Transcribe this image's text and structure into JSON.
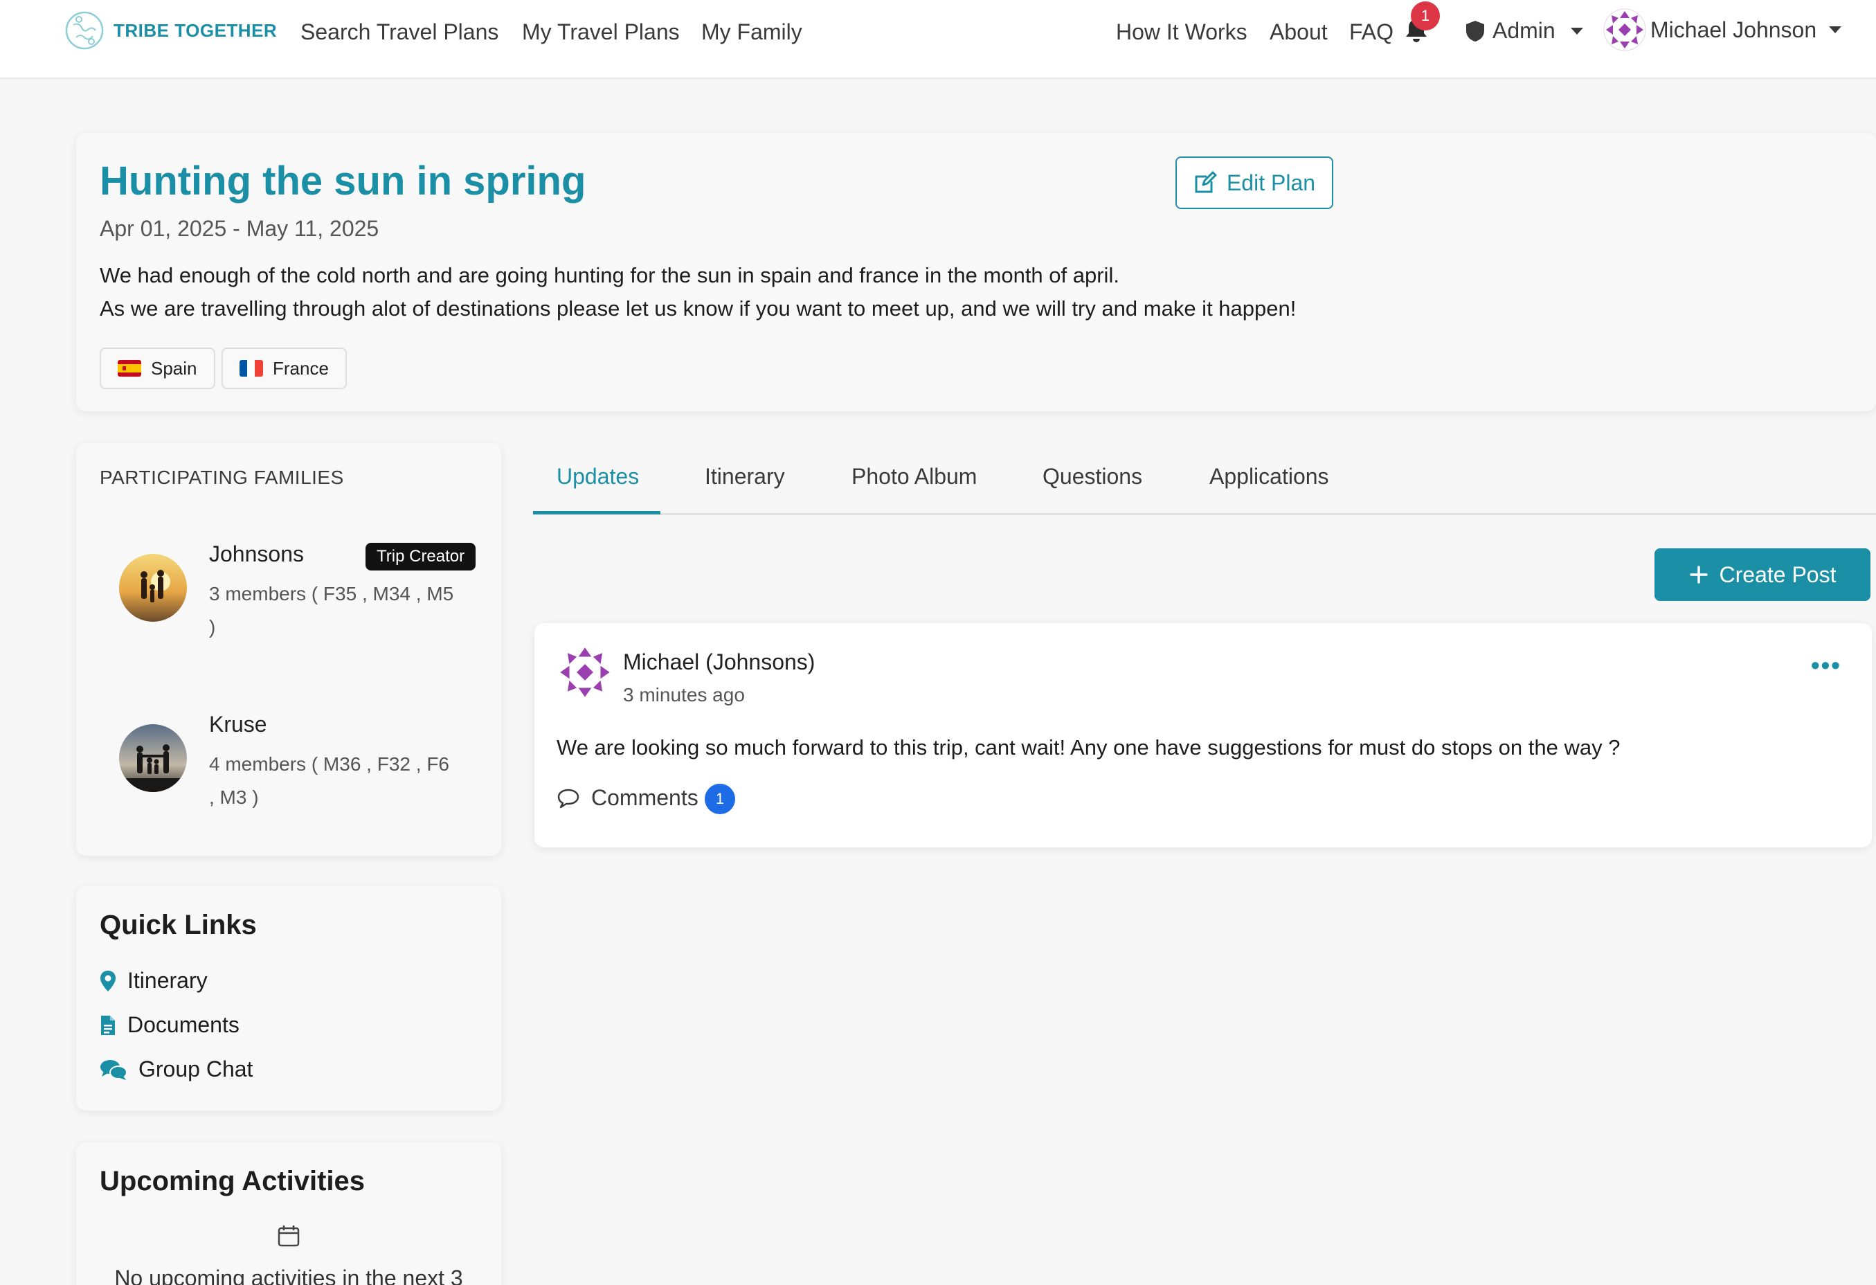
{
  "navbar": {
    "brand": "TRIBE TOGETHER",
    "links": [
      "Search Travel Plans",
      "My Travel Plans",
      "My Family"
    ],
    "right_links": [
      "How It Works",
      "About",
      "FAQ"
    ],
    "notification_count": "1",
    "admin_label": "Admin",
    "user_name": "Michael Johnson"
  },
  "plan": {
    "title": "Hunting the sun in spring",
    "dates": "Apr 01, 2025 - May 11, 2025",
    "description_line1": "We had enough of the cold north and are going hunting for the sun in spain and france in the month of april.",
    "description_line2": "As we are travelling through alot of destinations please let us know if you want to meet up, and we will try and make it happen!",
    "edit_label": "Edit Plan",
    "countries": [
      "Spain",
      "France"
    ]
  },
  "families": {
    "heading": "PARTICIPATING FAMILIES",
    "items": [
      {
        "name": "Johnsons",
        "badge": "Trip Creator",
        "members": "3 members ( F35 , M34 , M5 )"
      },
      {
        "name": "Kruse",
        "badge": "",
        "members": "4 members ( M36 , F32 , F6 , M3 )"
      }
    ]
  },
  "quick_links": {
    "heading": "Quick Links",
    "items": [
      "Itinerary",
      "Documents",
      "Group Chat"
    ]
  },
  "upcoming": {
    "heading": "Upcoming Activities",
    "empty_text": "No upcoming activities in the next 3"
  },
  "tabs": {
    "items": [
      "Updates",
      "Itinerary",
      "Photo Album",
      "Questions",
      "Applications"
    ],
    "active": "Updates"
  },
  "create_post_label": "Create Post",
  "post": {
    "author": "Michael (Johnsons)",
    "time": "3 minutes ago",
    "body": "We are looking so much forward to this trip, cant wait! Any one have suggestions for must do stops on the way ?",
    "comments_label": "Comments",
    "comments_count": "1"
  },
  "colors": {
    "accent": "#1a8fa6",
    "badge_red": "#dc3545",
    "badge_blue": "#1e6be6"
  }
}
